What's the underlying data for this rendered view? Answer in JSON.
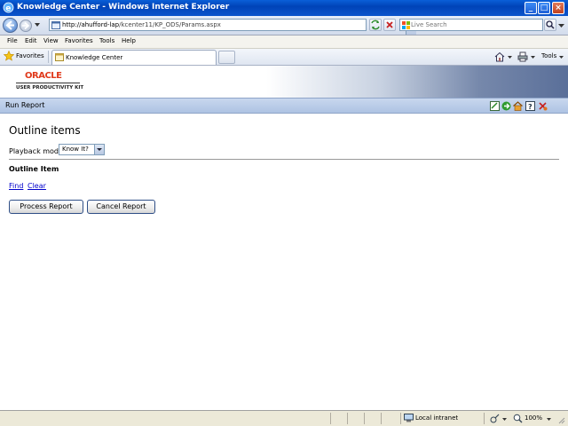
{
  "window": {
    "title": "Knowledge Center - Windows Internet Explorer"
  },
  "address": {
    "url_host": "http://ahufford-lap",
    "url_path": "/kcenter11/KP_ODS/Params.aspx"
  },
  "search": {
    "placeholder": "Live Search"
  },
  "menu": {
    "items": [
      "File",
      "Edit",
      "View",
      "Favorites",
      "Tools",
      "Help"
    ]
  },
  "favorites": {
    "label": "Favorites"
  },
  "tab": {
    "label": "Knowledge Center"
  },
  "commands": {
    "tools_label": "Tools"
  },
  "banner": {
    "brand": "ORACLE",
    "product": "USER PRODUCTIVITY KIT"
  },
  "runbar": {
    "title": "Run Report"
  },
  "content": {
    "heading": "Outline items",
    "playback_label": "Playback mode",
    "playback_value": "Know It?",
    "outline_item_label": "Outline Item",
    "find_link": "Find",
    "clear_link": "Clear",
    "process_button": "Process Report",
    "cancel_button": "Cancel Report"
  },
  "status": {
    "zone": "Local intranet",
    "zoom": "100%"
  },
  "colors": {
    "titlebar": "#0a5fd8",
    "runbar": "#aec3e3",
    "link": "#0000cc",
    "oracle_red": "#e03a1c"
  }
}
